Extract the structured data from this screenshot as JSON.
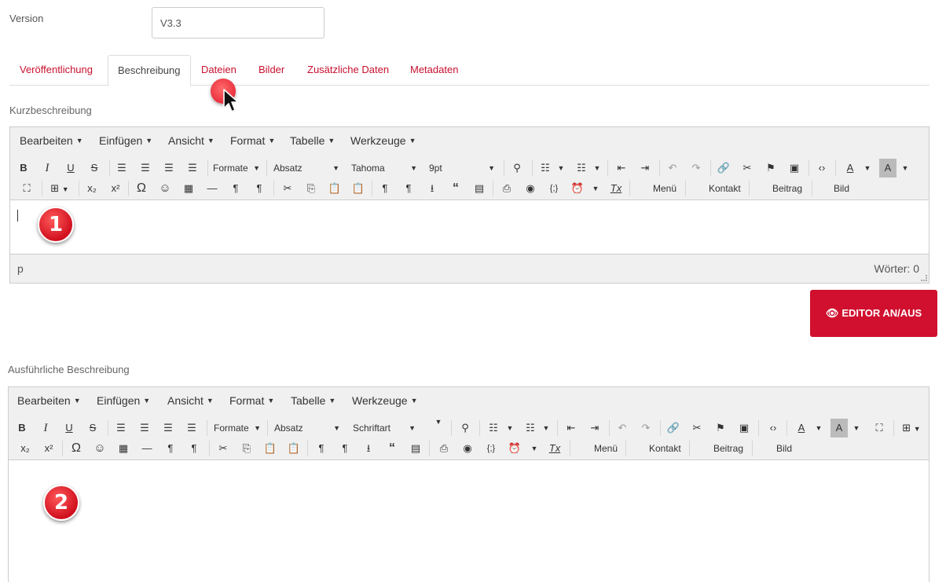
{
  "version": {
    "label": "Version",
    "value": "V3.3"
  },
  "tabs": [
    {
      "label": "Veröffentlichung",
      "active": false
    },
    {
      "label": "Beschreibung",
      "active": true
    },
    {
      "label": "Dateien",
      "active": false
    },
    {
      "label": "Bilder",
      "active": false
    },
    {
      "label": "Zusätzliche Daten",
      "active": false
    },
    {
      "label": "Metadaten",
      "active": false
    }
  ],
  "short_description": {
    "label": "Kurzbeschreibung",
    "menu": [
      "Bearbeiten",
      "Einfügen",
      "Ansicht",
      "Format",
      "Tabelle",
      "Werkzeuge"
    ],
    "formats": "Formate",
    "block": "Absatz",
    "font": "Tahoma",
    "size": "9pt",
    "custom_buttons": [
      "Menü",
      "Kontakt",
      "Beitrag",
      "Bild"
    ],
    "path": "p",
    "word_count": "Wörter: 0",
    "badge": "1"
  },
  "editor_toggle": {
    "label": "EDITOR AN/AUS"
  },
  "long_description": {
    "label": "Ausführliche Beschreibung",
    "menu": [
      "Bearbeiten",
      "Einfügen",
      "Ansicht",
      "Format",
      "Tabelle",
      "Werkzeuge"
    ],
    "formats": "Formate",
    "block": "Absatz",
    "font": "Schriftart",
    "custom_buttons": [
      "Menü",
      "Kontakt",
      "Beitrag",
      "Bild"
    ],
    "badge": "2"
  },
  "colors": {
    "accent": "#c8102e",
    "button": "#d0102e",
    "toolbar_bg": "#f0f0f0",
    "border": "#cccccc"
  }
}
